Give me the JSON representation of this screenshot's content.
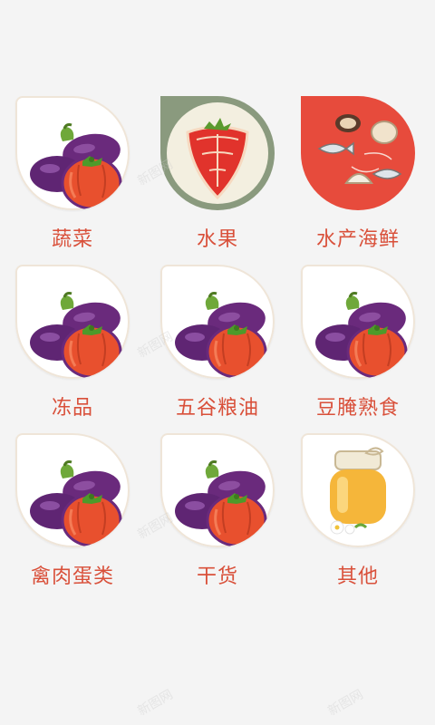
{
  "categories": [
    {
      "label": "蔬菜",
      "icon": "eggplant-tomato-icon"
    },
    {
      "label": "水果",
      "icon": "strawberry-icon"
    },
    {
      "label": "水产海鲜",
      "icon": "seafood-icon"
    },
    {
      "label": "冻品",
      "icon": "eggplant-tomato-icon"
    },
    {
      "label": "五谷粮油",
      "icon": "eggplant-tomato-icon"
    },
    {
      "label": "豆腌熟食",
      "icon": "eggplant-tomato-icon"
    },
    {
      "label": "禽肉蛋类",
      "icon": "eggplant-tomato-icon"
    },
    {
      "label": "干货",
      "icon": "eggplant-tomato-icon"
    },
    {
      "label": "其他",
      "icon": "honey-jar-icon"
    }
  ],
  "watermark": "新图网",
  "colors": {
    "label": "#d9503a",
    "seafood_bg": "#e74b3c",
    "fruit_bg": "#8a9a7e",
    "background": "#f4f4f4"
  }
}
